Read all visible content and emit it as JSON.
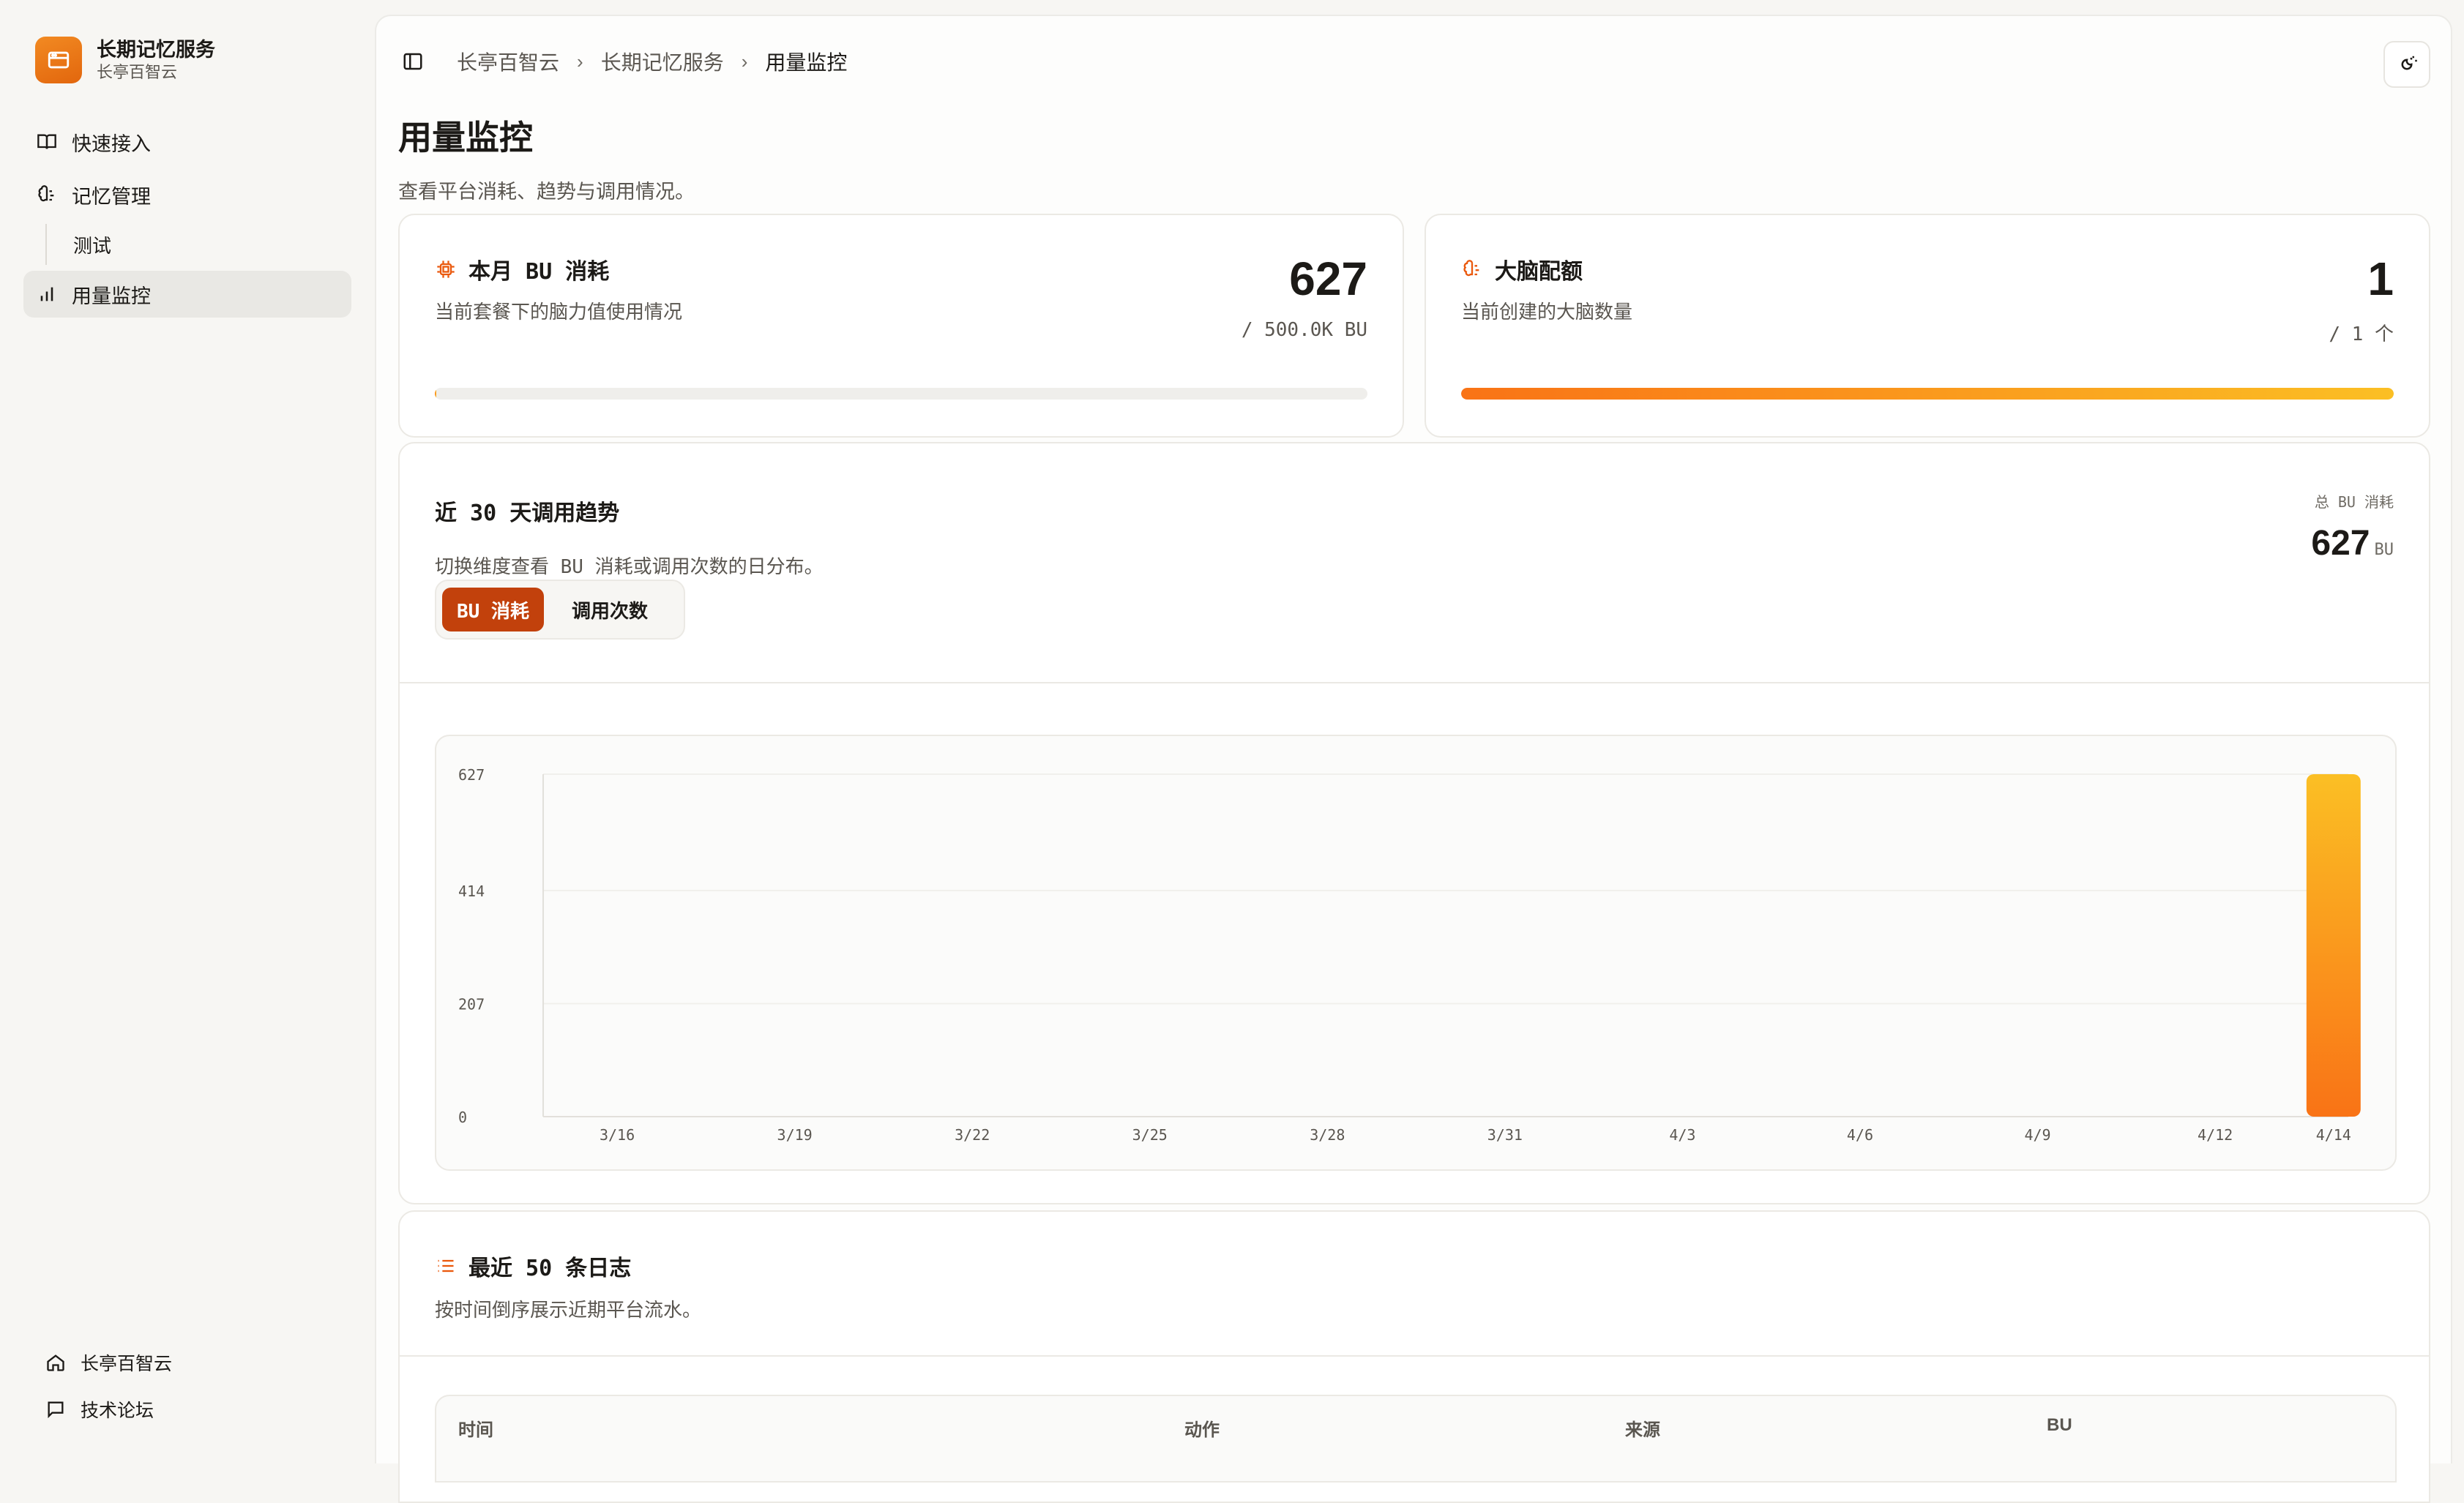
{
  "brand": {
    "title": "长期记忆服务",
    "subtitle": "长亭百智云",
    "logo_icon": "window-icon"
  },
  "nav": {
    "items": [
      {
        "label": "快速接入",
        "icon": "book-icon"
      },
      {
        "label": "记忆管理",
        "icon": "brain-icon"
      },
      {
        "label": "测试",
        "sub": true
      },
      {
        "label": "用量监控",
        "icon": "bar-chart-icon",
        "active": true
      }
    ]
  },
  "sidebar_bottom": [
    {
      "label": "长亭百智云",
      "icon": "home-icon"
    },
    {
      "label": "技术论坛",
      "icon": "message-icon"
    }
  ],
  "breadcrumb": [
    "长亭百智云",
    "长期记忆服务",
    "用量监控"
  ],
  "page": {
    "title": "用量监控",
    "description": "查看平台消耗、趋势与调用情况。"
  },
  "stats": {
    "bu": {
      "title": "本月 BU 消耗",
      "description": "当前套餐下的脑力值使用情况",
      "value": "627",
      "limit": "/ 500.0K BU",
      "progress": 0.0013
    },
    "brain": {
      "title": "大脑配额",
      "description": "当前创建的大脑数量",
      "value": "1",
      "limit": "/ 1 个",
      "progress": 1.0
    }
  },
  "trend": {
    "title": "近 30 天调用趋势",
    "description": "切换维度查看 BU 消耗或调用次数的日分布。",
    "total_label": "总 BU 消耗",
    "total_value": "627",
    "total_unit": "BU",
    "tabs": [
      "BU 消耗",
      "调用次数"
    ],
    "active_tab": 0
  },
  "chart_data": {
    "type": "bar",
    "categories": [
      "3/15",
      "3/16",
      "3/17",
      "3/18",
      "3/19",
      "3/20",
      "3/21",
      "3/22",
      "3/23",
      "3/24",
      "3/25",
      "3/26",
      "3/27",
      "3/28",
      "3/29",
      "3/30",
      "3/31",
      "4/1",
      "4/2",
      "4/3",
      "4/4",
      "4/5",
      "4/6",
      "4/7",
      "4/8",
      "4/9",
      "4/10",
      "4/11",
      "4/12",
      "4/13",
      "4/14"
    ],
    "values": [
      0,
      0,
      0,
      0,
      0,
      0,
      0,
      0,
      0,
      0,
      0,
      0,
      0,
      0,
      0,
      0,
      0,
      0,
      0,
      0,
      0,
      0,
      0,
      0,
      0,
      0,
      0,
      0,
      0,
      0,
      627
    ],
    "x_tick_labels": [
      "3/16",
      "3/19",
      "3/22",
      "3/25",
      "3/28",
      "3/31",
      "4/3",
      "4/6",
      "4/9",
      "4/12",
      "4/14"
    ],
    "y_ticks": [
      0,
      207,
      414,
      627
    ],
    "ylim": [
      0,
      627
    ],
    "colors": {
      "top": "#fbbf24",
      "bottom": "#f97316"
    }
  },
  "logs": {
    "title": "最近 50 条日志",
    "description": "按时间倒序展示近期平台流水。",
    "columns": [
      "时间",
      "动作",
      "来源",
      "BU"
    ]
  },
  "colors": {
    "accent": "#c2410c",
    "brand": "#f28a22"
  }
}
